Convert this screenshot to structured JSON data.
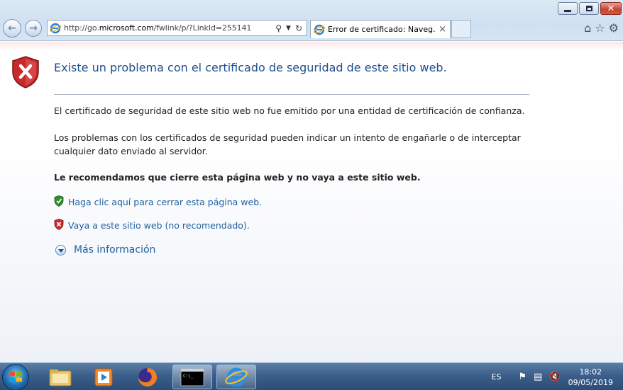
{
  "browser": {
    "url_prefix": "http://go.",
    "url_domain": "microsoft.com",
    "url_path": "/fwlink/p/?LinkId=255141",
    "tab_title": "Error de certificado: Naveg...",
    "tab_close": "×",
    "window_controls": {
      "minimize": "minimize-icon",
      "maximize": "restore-icon",
      "close": "close-icon",
      "close_glyph": "✕"
    },
    "tools": [
      "home-icon",
      "favorites-star-icon",
      "settings-gear-icon"
    ]
  },
  "page": {
    "title": "Existe un problema con el certificado de seguridad de este sitio web.",
    "paragraph1": "El certificado de seguridad de este sitio web no fue emitido por una entidad de certificación de confianza.",
    "paragraph2": "Los problemas con los certificados de seguridad pueden indicar un intento de engañarle o de interceptar cualquier dato enviado al servidor.",
    "recommendation": "Le recomendamos que cierre esta página web y no vaya a este sitio web.",
    "close_link": "Haga clic aquí para cerrar esta página web.",
    "continue_link": "Vaya a este sitio web (no recomendado).",
    "more_info": "Más información"
  },
  "colors": {
    "title_blue": "#1f4e8c",
    "link_blue": "#1f5fa0",
    "shield_red": "#c62a2a",
    "shield_green": "#2f8f2f"
  },
  "taskbar": {
    "apps": [
      "file-explorer-icon",
      "media-player-icon",
      "firefox-icon",
      "command-prompt-icon",
      "internet-explorer-icon"
    ],
    "language": "ES",
    "time": "18:02",
    "date": "09/05/2019"
  }
}
